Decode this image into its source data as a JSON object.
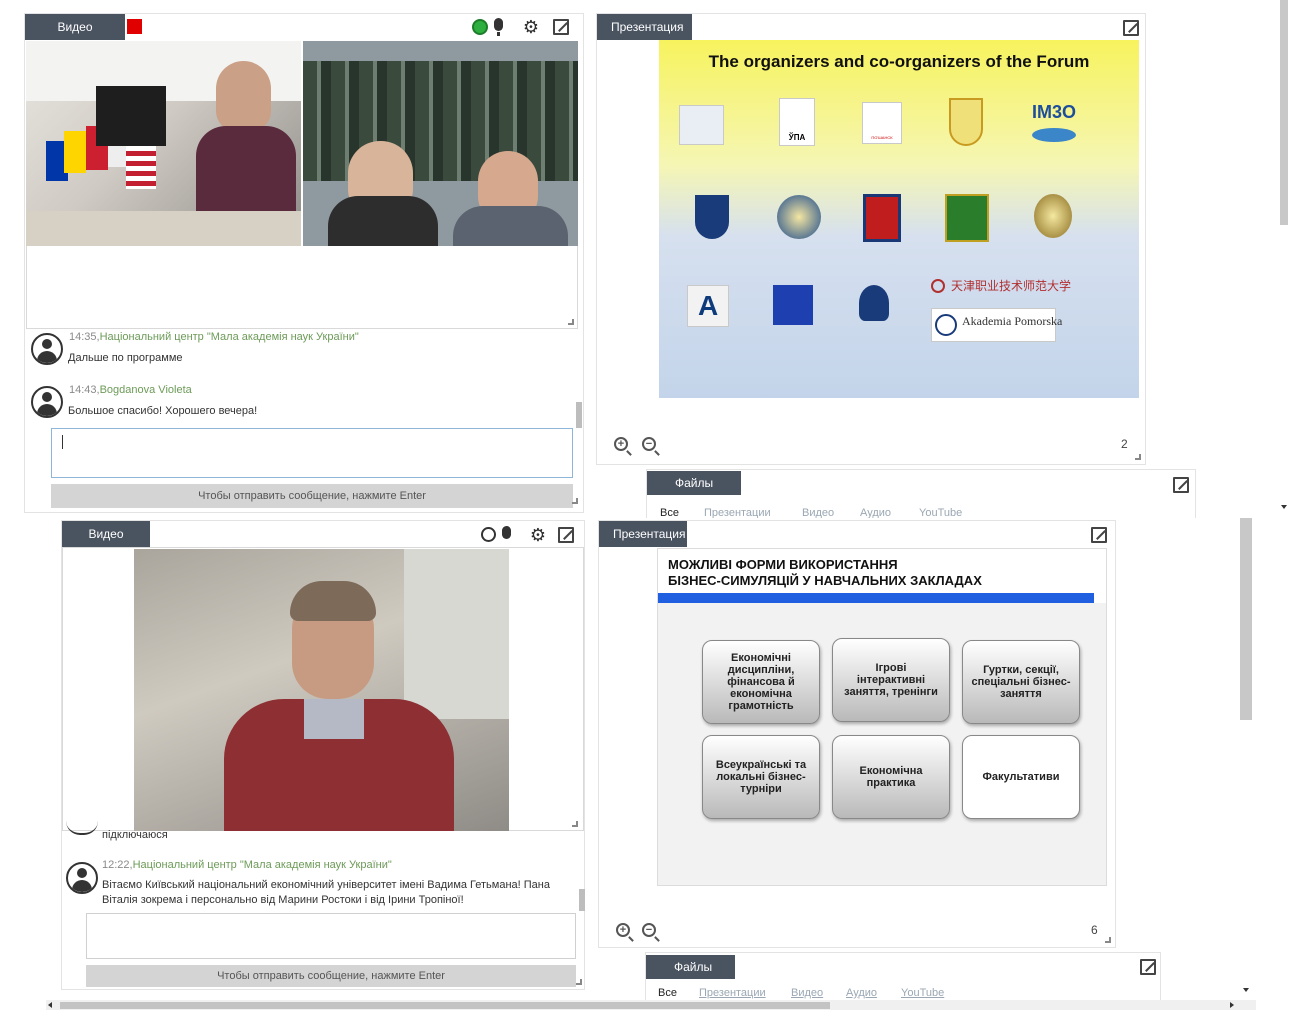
{
  "top": {
    "video_panel": {
      "tab": "Видео"
    },
    "chat": {
      "messages": [
        {
          "time": "14:35,",
          "author": "Національний центр \"Мала академія наук України\"",
          "text": "Дальше по программе"
        },
        {
          "time": "14:43,",
          "author": "Bogdanova Violeta",
          "text": "Большое спасибо! Хорошего вечера!"
        }
      ],
      "input_value": "",
      "send_hint": "Чтобы отправить сообщение, нажмите Enter"
    },
    "presentation": {
      "tab": "Презентация",
      "slide_title": "The organizers and co-organizers of the Forum",
      "page": "2",
      "logos": [
        {
          "label": "ЎПА"
        },
        {
          "label": "ПО'ШАНСК"
        },
        {
          "label": "IM3O"
        },
        {
          "label": "Akademia Pomorska"
        },
        {
          "label": "天津职业技术师范大学"
        }
      ]
    },
    "files": {
      "tab": "Файлы",
      "filters": [
        "Все",
        "Презентации",
        "Видео",
        "Аудио",
        "YouTube"
      ]
    }
  },
  "bottom": {
    "video_panel": {
      "tab": "Видео"
    },
    "chat": {
      "partial_line": "підключаюся",
      "messages": [
        {
          "time": "12:22,",
          "author": "Національний центр \"Мала академія наук України\"",
          "text": "Вітаємо Київський національний економічний університет імені Вадима Гетьмана! Пана Віталія зокрема і персонально від Марини Ростоки і від Ірини Тропіної!"
        }
      ],
      "input_value": "",
      "send_hint": "Чтобы отправить сообщение, нажмите Enter"
    },
    "presentation": {
      "tab": "Презентация",
      "slide_title_line1": "МОЖЛИВІ ФОРМИ ВИКОРИСТАННЯ",
      "slide_title_line2": "БІЗНЕС-СИМУЛЯЦІЙ У НАВЧАЛЬНИХ ЗАКЛАДАХ",
      "boxes": [
        "Економічні дисципліни, фінансова й економічна грамотність",
        "Ігрові інтерактивні заняття, тренінги",
        "Гуртки, секції, спеціальні бізнес-заняття",
        "Всеукраїнські та локальні бізнес-турніри",
        "Економічна практика",
        "Факультативи"
      ],
      "page": "6"
    },
    "files": {
      "tab": "Файлы",
      "filters": [
        "Все",
        "Презентации",
        "Видео",
        "Аудио",
        "YouTube"
      ]
    }
  },
  "colors": {
    "tab_bg": "#4a5360",
    "accent_green": "#6d9b58",
    "record_red": "#e00000",
    "slide_bar_blue": "#1f5fe0"
  },
  "icons": [
    "record-icon",
    "presenter-icon",
    "microphone-icon",
    "gear-icon",
    "expand-icon",
    "zoom-in-icon",
    "zoom-out-icon",
    "avatar-icon"
  ]
}
